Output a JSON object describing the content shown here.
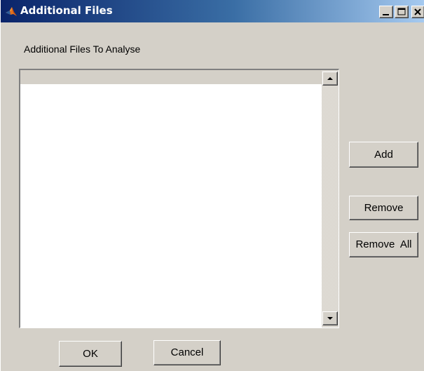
{
  "window": {
    "title": "Additional Files",
    "controls": {
      "minimize_icon": "minimize-icon",
      "maximize_icon": "maximize-icon",
      "close_icon": "close-icon"
    }
  },
  "main": {
    "section_label": "Additional Files To Analyse",
    "file_list": {
      "items": []
    }
  },
  "side_buttons": {
    "add_label": "Add",
    "remove_label": "Remove",
    "remove_all_label": "Remove  All"
  },
  "footer": {
    "ok_label": "OK",
    "cancel_label": "Cancel"
  },
  "colors": {
    "title_bar_start": "#0a246a",
    "title_bar_end": "#a6caf0",
    "window_background": "#d4d0c8",
    "list_background": "#ffffff"
  }
}
